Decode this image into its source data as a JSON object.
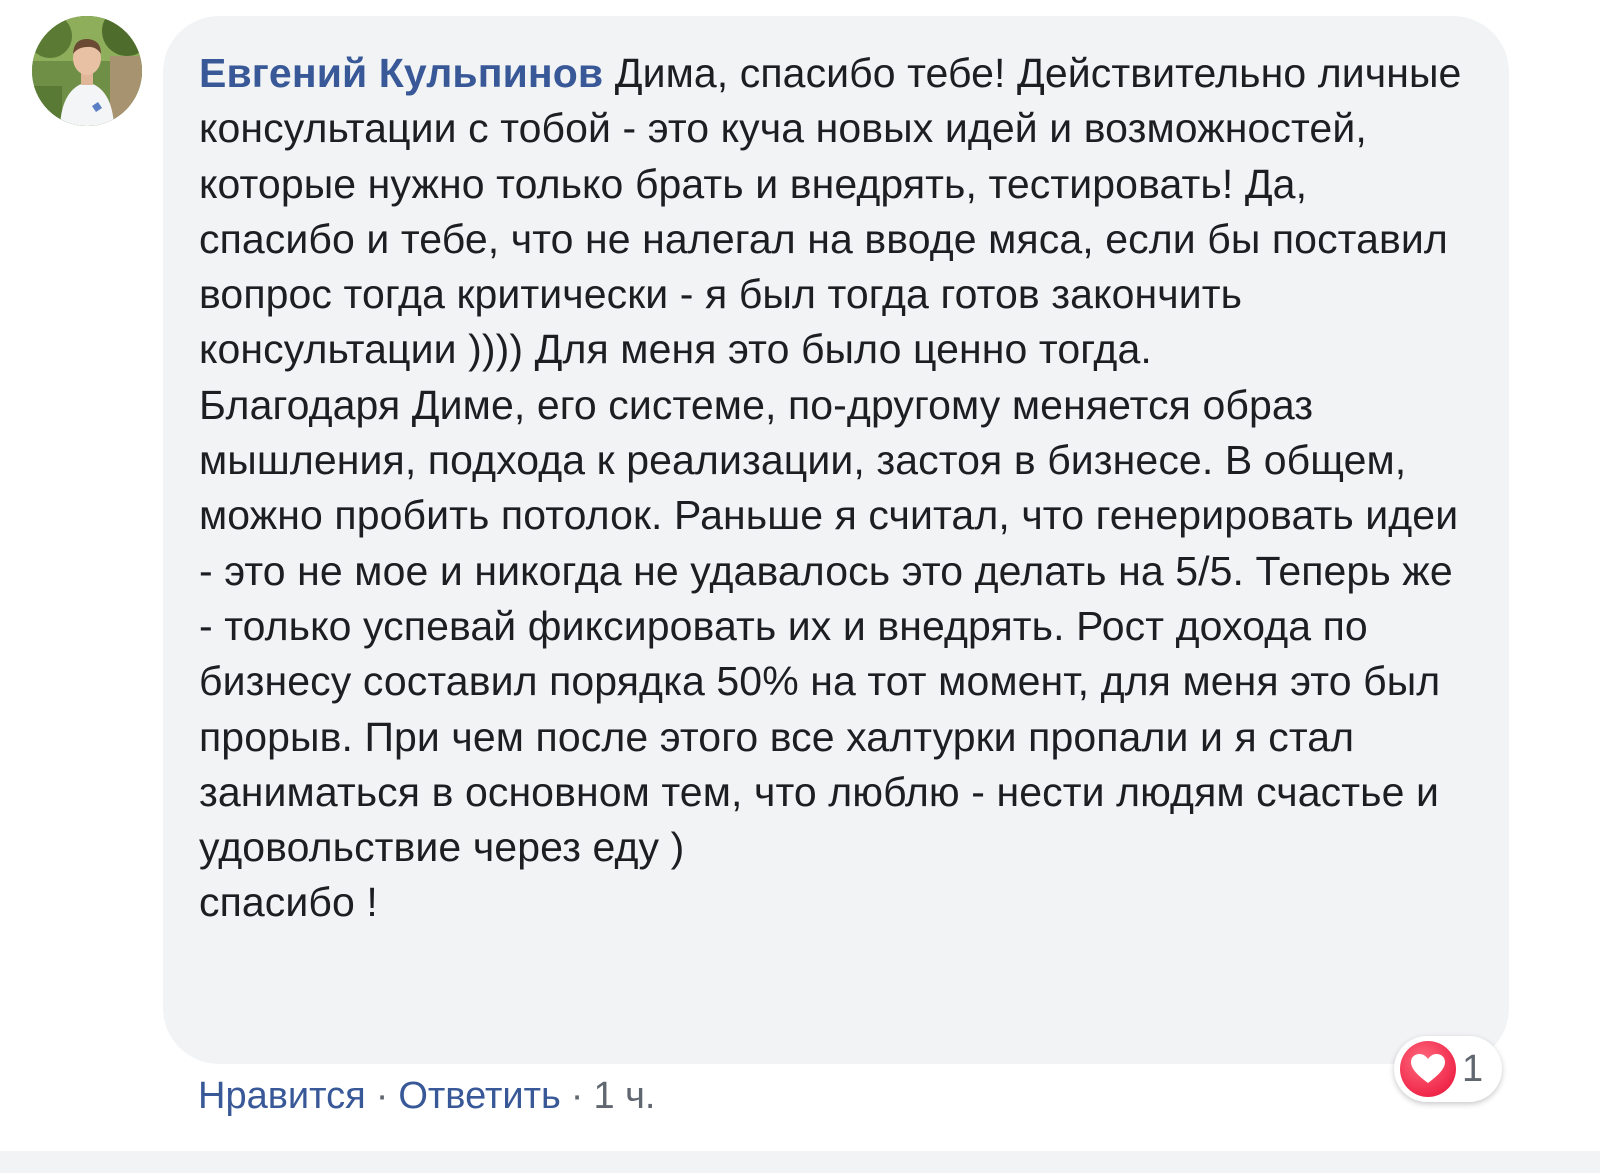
{
  "comment": {
    "author": "Евгений Кульпинов",
    "text_first": "Дима, спасибо тебе! Действительно личные консультации с тобой - это куча новых идей и возможностей, которые нужно только брать и внедрять, тестировать! Да, спасибо и тебе, что не налегал на вводе мяса, если бы поставил вопрос тогда критически - я был тогда готов закончить консультации )))) Для меня это было ценно тогда.",
    "text_second": "Благодаря Диме, его системе, по-другому меняется образ мышления, подхода к реализации, застоя в бизнесе. В общем, можно пробить потолок. Раньше я считал, что генерировать идеи - это не мое и никогда не удавалось это делать на 5/5. Теперь же - только успевай фиксировать их и внедрять. Рост дохода по бизнесу составил порядка 50% на тот момент, для меня это был прорыв. При чем после этого все халтурки пропали и я стал заниматься в основном тем, что люблю - нести людям счастье и удовольствие через еду )",
    "text_third": "спасибо !"
  },
  "actions": {
    "like_label": "Нравится",
    "reply_label": "Ответить",
    "separator": "·",
    "timestamp": "1 ч."
  },
  "reaction": {
    "icon": "heart-icon",
    "count": "1",
    "color": "#f33e58"
  },
  "colors": {
    "link": "#385898",
    "text": "#1c1e21",
    "meta": "#606770",
    "bubble": "#f2f3f5"
  }
}
